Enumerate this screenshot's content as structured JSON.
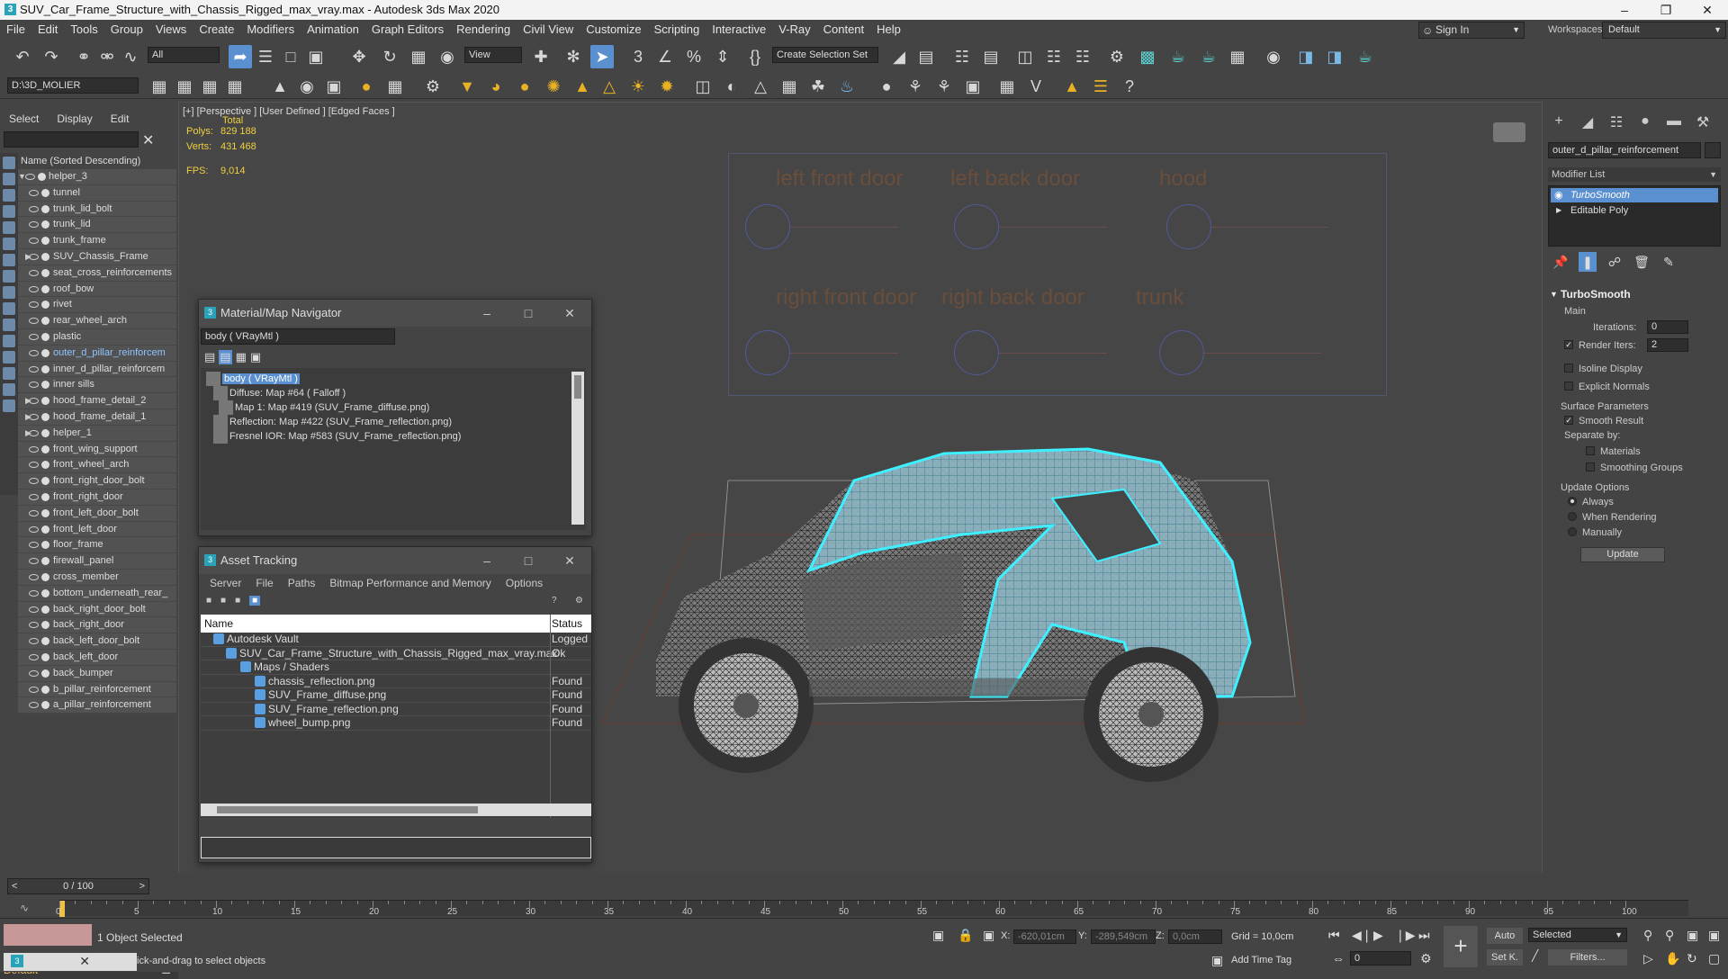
{
  "window": {
    "title": "SUV_Car_Frame_Structure_with_Chassis_Rigged_max_vray.max - Autodesk 3ds Max 2020",
    "icon_label": "3"
  },
  "menus": [
    "File",
    "Edit",
    "Tools",
    "Group",
    "Views",
    "Create",
    "Modifiers",
    "Animation",
    "Graph Editors",
    "Rendering",
    "Civil View",
    "Customize",
    "Scripting",
    "Interactive",
    "V-Ray",
    "Content",
    "Help"
  ],
  "signin": "Sign In",
  "workspaces": {
    "label": "Workspaces:",
    "value": "Default"
  },
  "toolbar": {
    "filter": "All",
    "view": "View",
    "selection_set": "Create Selection Set",
    "project_path": "D:\\3D_MOLIER"
  },
  "scene_explorer": {
    "menu": [
      "Select",
      "Display",
      "Edit"
    ],
    "header": "Name (Sorted Descending)",
    "items": [
      {
        "name": "helper_3",
        "level": 0,
        "expand": true
      },
      {
        "name": "tunnel",
        "level": 1
      },
      {
        "name": "trunk_lid_bolt",
        "level": 1
      },
      {
        "name": "trunk_lid",
        "level": 1
      },
      {
        "name": "trunk_frame",
        "level": 1
      },
      {
        "name": "SUV_Chassis_Frame",
        "level": 1,
        "expand": true
      },
      {
        "name": "seat_cross_reinforcements",
        "level": 1
      },
      {
        "name": "roof_bow",
        "level": 1
      },
      {
        "name": "rivet",
        "level": 1
      },
      {
        "name": "rear_wheel_arch",
        "level": 1
      },
      {
        "name": "plastic",
        "level": 1
      },
      {
        "name": "outer_d_pillar_reinforcem",
        "level": 1,
        "selected": true
      },
      {
        "name": "inner_d_pillar_reinforcem",
        "level": 1
      },
      {
        "name": "inner sills",
        "level": 1
      },
      {
        "name": "hood_frame_detail_2",
        "level": 1,
        "expand": true
      },
      {
        "name": "hood_frame_detail_1",
        "level": 1,
        "expand": true
      },
      {
        "name": "helper_1",
        "level": 1,
        "expand": true
      },
      {
        "name": "front_wing_support",
        "level": 1
      },
      {
        "name": "front_wheel_arch",
        "level": 1
      },
      {
        "name": "front_right_door_bolt",
        "level": 1
      },
      {
        "name": "front_right_door",
        "level": 1
      },
      {
        "name": "front_left_door_bolt",
        "level": 1
      },
      {
        "name": "front_left_door",
        "level": 1
      },
      {
        "name": "floor_frame",
        "level": 1
      },
      {
        "name": "firewall_panel",
        "level": 1
      },
      {
        "name": "cross_member",
        "level": 1
      },
      {
        "name": "bottom_underneath_rear_",
        "level": 1
      },
      {
        "name": "back_right_door_bolt",
        "level": 1
      },
      {
        "name": "back_right_door",
        "level": 1
      },
      {
        "name": "back_left_door_bolt",
        "level": 1
      },
      {
        "name": "back_left_door",
        "level": 1
      },
      {
        "name": "back_bumper",
        "level": 1
      },
      {
        "name": "b_pillar_reinforcement",
        "level": 1
      },
      {
        "name": "a_pillar_reinforcement",
        "level": 1
      }
    ],
    "layer": "Default"
  },
  "viewport": {
    "label": "[+] [Perspective ] [User Defined ] [Edged Faces ]",
    "total": "Total",
    "polys_label": "Polys:",
    "polys": "829 188",
    "verts_label": "Verts:",
    "verts": "431 468",
    "fps_label": "FPS:",
    "fps": "9,014",
    "tags": [
      "left front door",
      "left back door",
      "hood",
      "right front door",
      "right back door",
      "trunk"
    ]
  },
  "material_navigator": {
    "title": "Material/Map Navigator",
    "field": "body  ( VRayMtl )",
    "tree": [
      "body  ( VRayMtl )",
      "Diffuse: Map #64  ( Falloff )",
      "Map 1: Map #419 (SUV_Frame_diffuse.png)",
      "Reflection: Map #422 (SUV_Frame_reflection.png)",
      "Fresnel IOR: Map #583 (SUV_Frame_reflection.png)"
    ]
  },
  "asset_tracking": {
    "title": "Asset Tracking",
    "menu": [
      "Server",
      "File",
      "Paths",
      "Bitmap Performance and Memory",
      "Options"
    ],
    "columns": [
      "Name",
      "Status"
    ],
    "rows": [
      {
        "name": "Autodesk Vault",
        "status": "Logged O",
        "indent": 14
      },
      {
        "name": "SUV_Car_Frame_Structure_with_Chassis_Rigged_max_vray.max",
        "status": "Ok",
        "indent": 28
      },
      {
        "name": "Maps / Shaders",
        "status": "",
        "indent": 44
      },
      {
        "name": "chassis_reflection.png",
        "status": "Found",
        "indent": 60
      },
      {
        "name": "SUV_Frame_diffuse.png",
        "status": "Found",
        "indent": 60
      },
      {
        "name": "SUV_Frame_reflection.png",
        "status": "Found",
        "indent": 60
      },
      {
        "name": "wheel_bump.png",
        "status": "Found",
        "indent": 60
      }
    ]
  },
  "command_panel": {
    "object_name": "outer_d_pillar_reinforcement",
    "modifier_list": "Modifier List",
    "stack": [
      "TurboSmooth",
      "Editable Poly"
    ],
    "rollout_title": "TurboSmooth",
    "main": "Main",
    "iterations_label": "Iterations:",
    "iterations": "0",
    "render_iters_label": "Render Iters:",
    "render_iters": "2",
    "isoline": "Isoline Display",
    "explicit_normals": "Explicit Normals",
    "surface_params": "Surface Parameters",
    "smooth_result": "Smooth Result",
    "separate_by": "Separate by:",
    "materials": "Materials",
    "smoothing_groups": "Smoothing Groups",
    "update_options": "Update Options",
    "always": "Always",
    "when_rendering": "When Rendering",
    "manually": "Manually",
    "update_btn": "Update"
  },
  "timeline": {
    "frame": "0 / 100",
    "ticks": [
      "0",
      "5",
      "10",
      "15",
      "20",
      "25",
      "30",
      "35",
      "40",
      "45",
      "50",
      "55",
      "60",
      "65",
      "70",
      "75",
      "80",
      "85",
      "90",
      "95",
      "100"
    ]
  },
  "status": {
    "selected": "1 Object Selected",
    "hint": "ick-and-drag to select objects",
    "x_label": "X:",
    "x": "-620,01cm",
    "y_label": "Y:",
    "y": "-289,549cm",
    "z_label": "Z:",
    "z": "0,0cm",
    "grid": "Grid = 10,0cm",
    "add_time_tag": "Add Time Tag",
    "auto": "Auto",
    "selected_dd": "Selected",
    "setk": "Set K.",
    "filters": "Filters...",
    "frame_field": "0"
  }
}
